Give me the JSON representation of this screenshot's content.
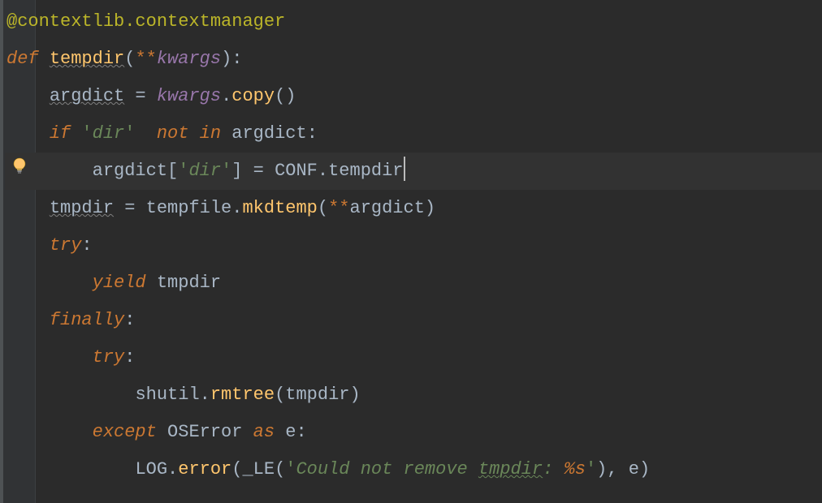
{
  "code": {
    "l1": {
      "decorator": "@contextlib.contextmanager"
    },
    "l2": {
      "def": "def",
      "name": "tempdir",
      "lp": "(",
      "stars": "**",
      "kwargs": "kwargs",
      "rp": "):"
    },
    "l3": {
      "argdict": "argdict",
      "eq": " = ",
      "kwargs": "kwargs",
      "dot": ".",
      "copy": "copy",
      "call": "()"
    },
    "l4": {
      "if": "if",
      "sp": " ",
      "q1": "'",
      "dir": "dir",
      "q2": "'",
      "sp2": "  ",
      "not": "not",
      "sp3": " ",
      "in": "in",
      "sp4": " ",
      "argdict": "argdict",
      "colon": ":"
    },
    "l5": {
      "argdict": "argdict",
      "lb": "[",
      "q1": "'",
      "dir": "dir",
      "q2": "'",
      "rb": "]",
      "eq": " = ",
      "conf": "CONF",
      "dot": ".",
      "tempdir": "tempdir"
    },
    "l6": {
      "tmpdir": "tmpdir",
      "eq": " = ",
      "tempfile": "tempfile",
      "dot": ".",
      "mkdtemp": "mkdtemp",
      "lp": "(",
      "stars": "**",
      "argdict": "argdict",
      "rp": ")"
    },
    "l7": {
      "try": "try",
      "colon": ":"
    },
    "l8": {
      "yield": "yield",
      "sp": " ",
      "tmpdir": "tmpdir"
    },
    "l9": {
      "finally": "finally",
      "colon": ":"
    },
    "l10": {
      "try": "try",
      "colon": ":"
    },
    "l11": {
      "shutil": "shutil",
      "dot": ".",
      "rmtree": "rmtree",
      "lp": "(",
      "tmpdir": "tmpdir",
      "rp": ")"
    },
    "l12": {
      "except": "except",
      "sp": " ",
      "oserror": "OSError",
      "sp2": " ",
      "as": "as",
      "sp3": " ",
      "e": "e",
      "colon": ":"
    },
    "l13": {
      "log": "LOG",
      "dot": ".",
      "error": "error",
      "lp": "(",
      "le": "_LE",
      "lp2": "(",
      "q1": "'",
      "s1": "Could not remove ",
      "s2": "tmpdir",
      "s3": ": ",
      "fmt": "%s",
      "q2": "'",
      "rp2": ")",
      "comma": ", ",
      "e": "e",
      "rp": ")"
    }
  },
  "indent": {
    "i0": "",
    "i1": "    ",
    "i2": "        ",
    "i3": "            ",
    "i4": "                "
  }
}
